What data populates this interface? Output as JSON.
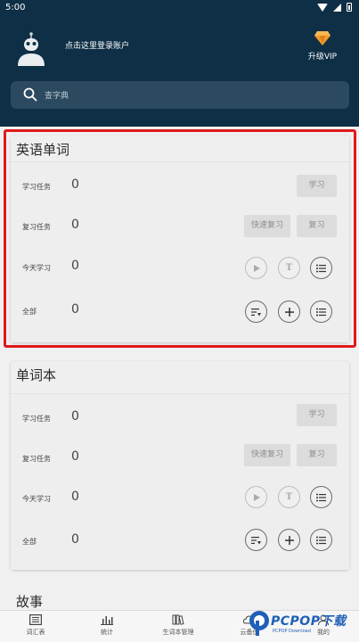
{
  "status_bar": {
    "time": "5:00"
  },
  "account": {
    "login_prompt": "点击这里登录账户",
    "vip_label": "升级VIP"
  },
  "search": {
    "placeholder": "查字典"
  },
  "sections": [
    {
      "title": "英语单词",
      "rows": [
        {
          "label": "学习任务",
          "count": "0",
          "buttons": [
            "学习"
          ]
        },
        {
          "label": "复习任务",
          "count": "0",
          "buttons": [
            "快速复习",
            "复习"
          ]
        },
        {
          "label": "今天学习",
          "count": "0",
          "icons": [
            "play-icon",
            "text-t-icon",
            "list-icon"
          ]
        },
        {
          "label": "全部",
          "count": "0",
          "icons": [
            "sort-list-icon",
            "plus-icon",
            "list-icon"
          ]
        }
      ]
    },
    {
      "title": "单词本",
      "rows": [
        {
          "label": "学习任务",
          "count": "0",
          "buttons": [
            "学习"
          ]
        },
        {
          "label": "复习任务",
          "count": "0",
          "buttons": [
            "快速复习",
            "复习"
          ]
        },
        {
          "label": "今天学习",
          "count": "0",
          "icons": [
            "play-icon",
            "text-t-icon",
            "list-icon"
          ]
        },
        {
          "label": "全部",
          "count": "0",
          "icons": [
            "sort-list-icon",
            "plus-icon",
            "list-icon"
          ]
        }
      ]
    },
    {
      "title": "故事"
    }
  ],
  "bottom_nav": [
    {
      "label": "词汇表",
      "icon": "vocabulary-icon"
    },
    {
      "label": "统计",
      "icon": "chart-icon"
    },
    {
      "label": "生词本管理",
      "icon": "books-icon"
    },
    {
      "label": "云备份",
      "icon": "cloud-icon"
    },
    {
      "label": "我的",
      "icon": "profile-icon"
    }
  ],
  "watermark": {
    "text": "PCPOP下载",
    "sub": "PCPOP Download"
  },
  "colors": {
    "header_bg": "#0e2f46",
    "highlight": "#e0191b",
    "button_bg": "#dcdcdc"
  }
}
